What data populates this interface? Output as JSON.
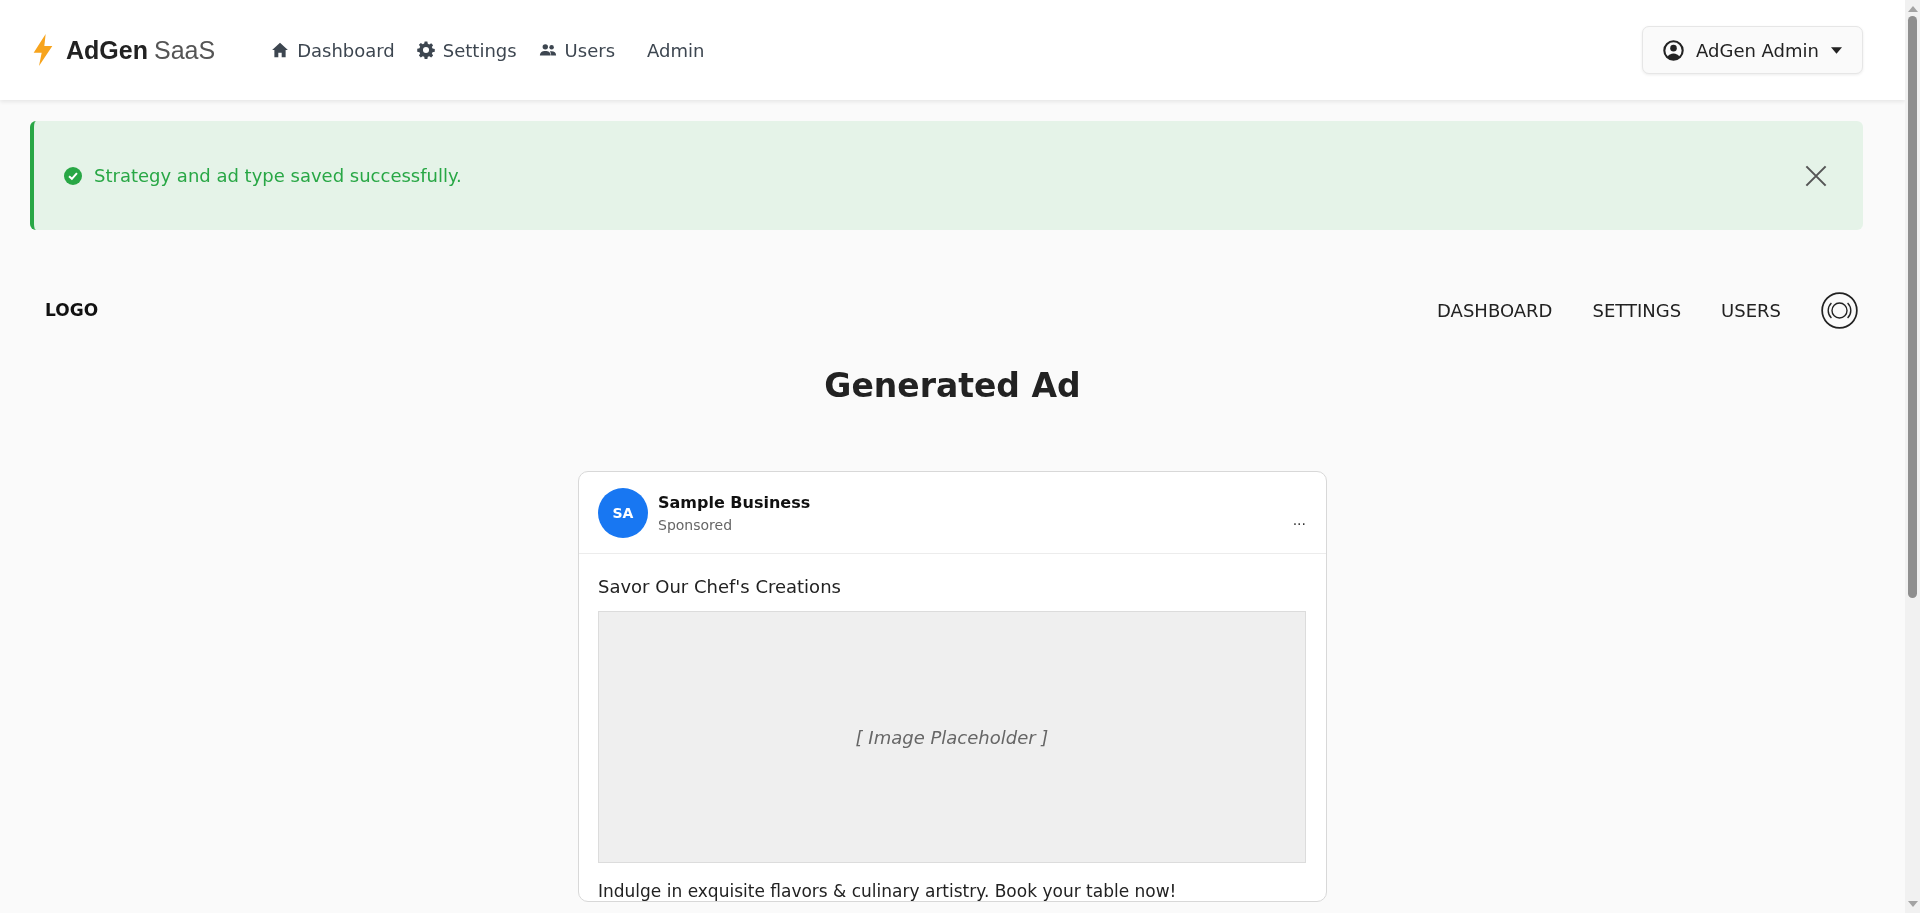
{
  "brand": {
    "name": "AdGen",
    "suffix": "SaaS"
  },
  "nav": [
    {
      "label": "Dashboard",
      "kind": "home"
    },
    {
      "label": "Settings",
      "kind": "settings"
    },
    {
      "label": "Users",
      "kind": "users"
    },
    {
      "label": "Admin",
      "kind": "plain"
    }
  ],
  "user_menu": {
    "label": "AdGen Admin"
  },
  "alert": {
    "kind": "success",
    "message": "Strategy and ad type saved successfully."
  },
  "preview_nav": {
    "logo": "LOGO",
    "links": [
      "DASHBOARD",
      "SETTINGS",
      "USERS"
    ]
  },
  "heading": "Generated Ad",
  "ad": {
    "avatar": "SA",
    "business": "Sample Business",
    "sponsored": "Sponsored",
    "more": "...",
    "headline": "Savor Our Chef's Creations",
    "image_placeholder": "[ Image Placeholder ]",
    "description": "Indulge in exquisite flavors & culinary artistry. Book your table now!"
  }
}
